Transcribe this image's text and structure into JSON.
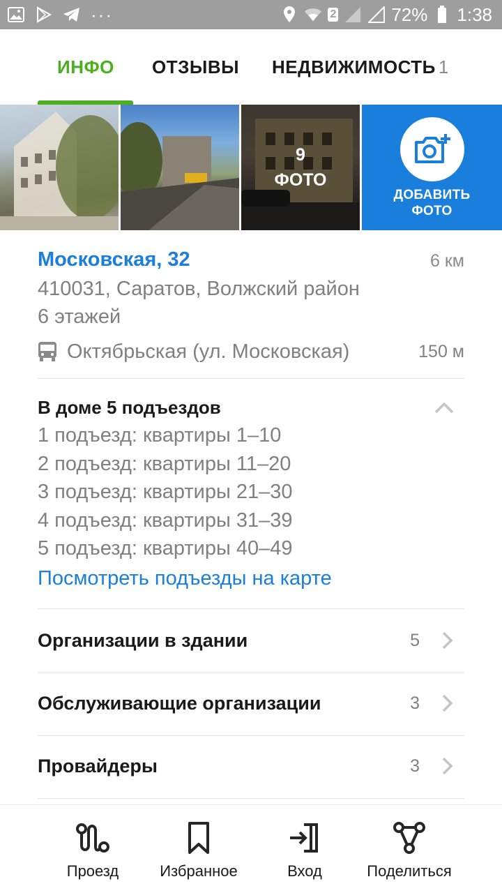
{
  "status_bar": {
    "battery": "72%",
    "time": "1:38",
    "sim_badge": "2",
    "more": "···"
  },
  "tabs": [
    {
      "label": "ИНФО",
      "active": true
    },
    {
      "label": "ОТЗЫВЫ",
      "active": false
    },
    {
      "label": "НЕДВИЖИМОСТЬ",
      "count": "1",
      "active": false
    }
  ],
  "photos": {
    "count": "9",
    "count_label": "ФОТО",
    "add_line1": "ДОБАВИТЬ",
    "add_line2": "ФОТО"
  },
  "address": {
    "title": "Московская, 32",
    "distance": "6 км",
    "line1": "410031, Саратов, Волжский район",
    "line2": "6 этажей"
  },
  "transit": {
    "icon": "bus-icon",
    "stop": "Октябрьская (ул. Московская)",
    "distance": "150 м"
  },
  "entrances": {
    "title": "В доме 5 подъездов",
    "items": [
      "1 подъезд: квартиры 1–10",
      "2 подъезд: квартиры 11–20",
      "3 подъезд: квартиры 21–30",
      "4 подъезд: квартиры 31–39",
      "5 подъезд: квартиры 40–49"
    ],
    "map_link": "Посмотреть подъезды на карте"
  },
  "rows": [
    {
      "label": "Организации в здании",
      "count": "5"
    },
    {
      "label": "Обслуживающие организации",
      "count": "3"
    },
    {
      "label": "Провайдеры",
      "count": "3"
    }
  ],
  "bottom_bar": [
    {
      "label": "Проезд",
      "icon": "route-icon"
    },
    {
      "label": "Избранное",
      "icon": "bookmark-icon"
    },
    {
      "label": "Вход",
      "icon": "login-icon"
    },
    {
      "label": "Поделиться",
      "icon": "share-icon"
    }
  ],
  "colors": {
    "accent_green": "#4caf1e",
    "link_blue": "#1a7fdc",
    "status_bar": "#9e9e9e"
  }
}
